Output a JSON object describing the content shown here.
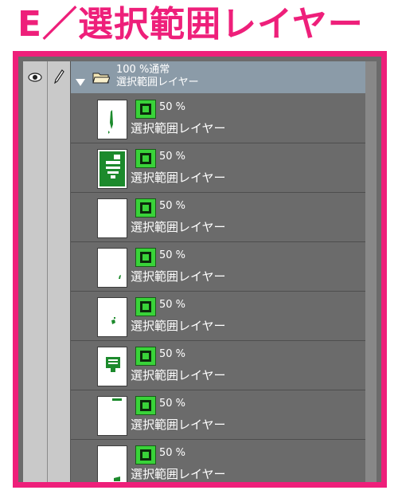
{
  "heading": "E／選択範囲レイヤー",
  "panel": {
    "folder": {
      "opacity_mode": "100 %通常",
      "name": "選択範囲レイヤー",
      "expanded": true
    },
    "layers": [
      {
        "opacity": "50 %",
        "name": "選択範囲レイヤー"
      },
      {
        "opacity": "50 %",
        "name": "選択範囲レイヤー"
      },
      {
        "opacity": "50 %",
        "name": "選択範囲レイヤー"
      },
      {
        "opacity": "50 %",
        "name": "選択範囲レイヤー"
      },
      {
        "opacity": "50 %",
        "name": "選択範囲レイヤー"
      },
      {
        "opacity": "50 %",
        "name": "選択範囲レイヤー"
      },
      {
        "opacity": "50 %",
        "name": "選択範囲レイヤー"
      },
      {
        "opacity": "50 %",
        "name": "選択範囲レイヤー"
      }
    ]
  },
  "colors": {
    "accent": "#ee1f7a",
    "selection_green": "#1c8a2c",
    "mask_icon_green": "#39d339",
    "panel_bg": "#6b6b6b",
    "folder_row_bg": "#8b9ba8"
  },
  "icons": {
    "visibility": "eye-icon",
    "lock": "pen-icon",
    "disclosure": "triangle-down-icon",
    "folder": "folder-icon",
    "mask": "selection-mask-icon"
  }
}
